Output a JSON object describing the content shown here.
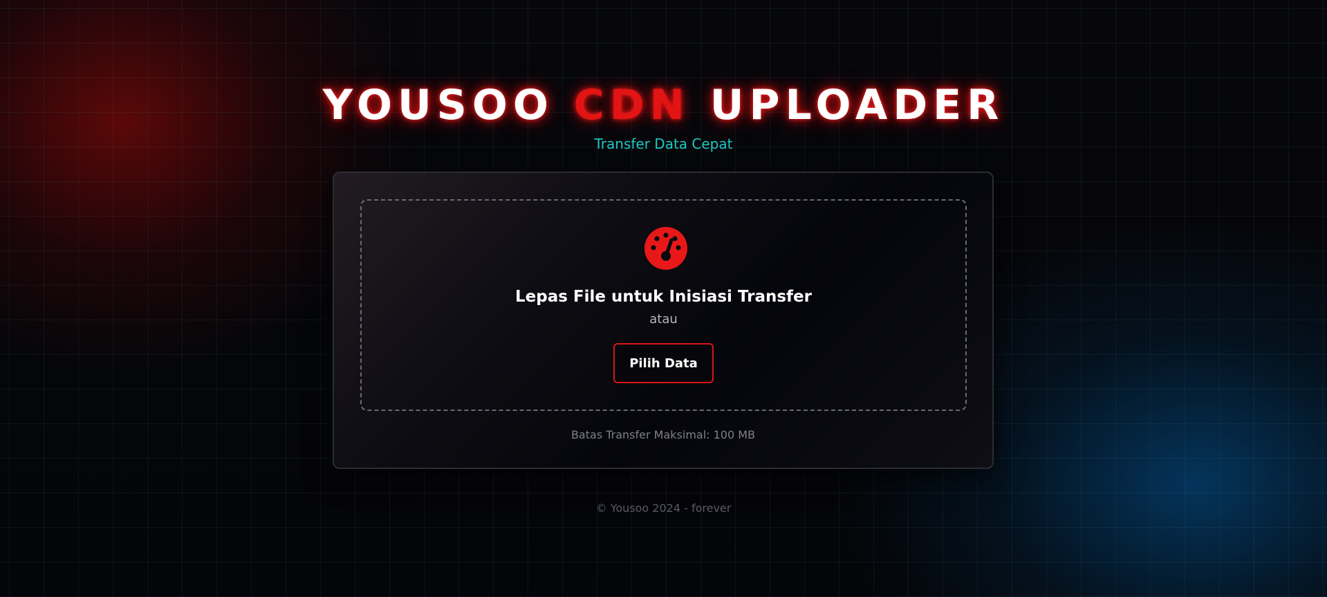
{
  "header": {
    "title_part1": "YOUSOO ",
    "title_accent": "CDN",
    "title_part2": " UPLOADER",
    "subtitle": "Transfer Data Cepat"
  },
  "upload": {
    "icon": "gauge-icon",
    "drop_title": "Lepas File untuk Inisiasi Transfer",
    "or_text": "atau",
    "button_label": "Pilih Data",
    "limit_text": "Batas Transfer Maksimal: 100 MB"
  },
  "footer": {
    "text": "© Yousoo 2024 - forever"
  },
  "colors": {
    "accent_red": "#e31414",
    "accent_cyan": "#20c8c4",
    "background": "#040508"
  }
}
